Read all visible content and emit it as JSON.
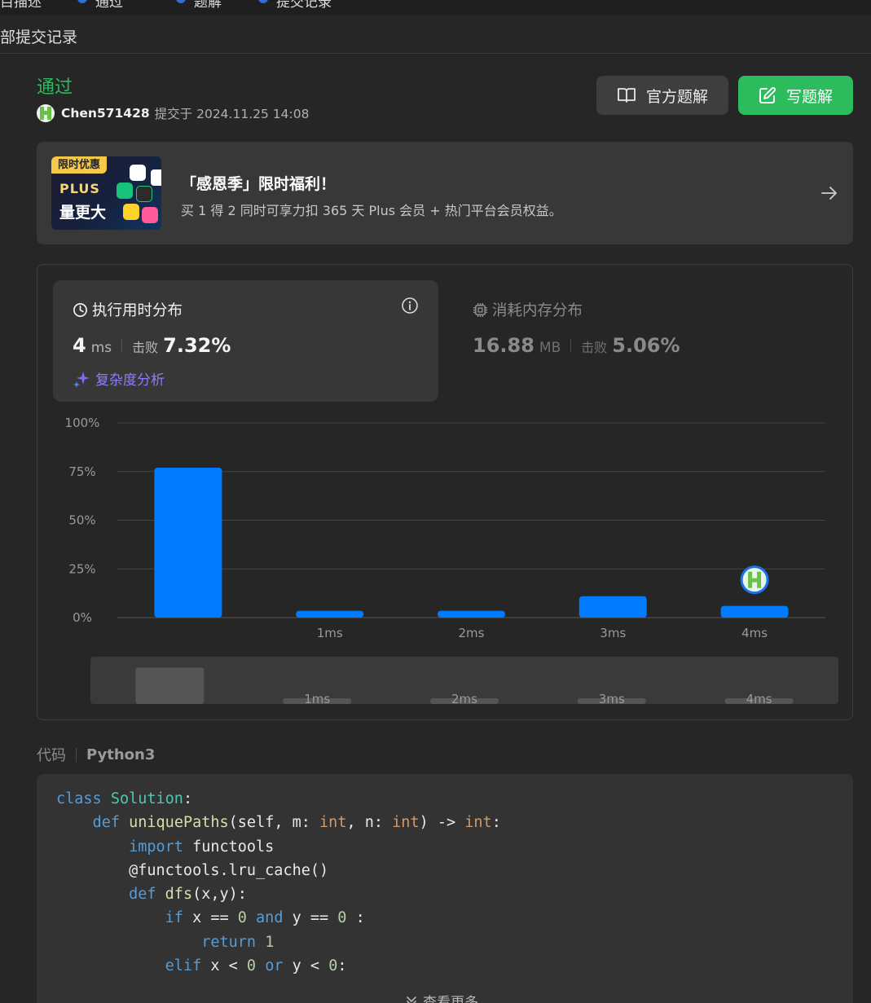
{
  "top_tabs": [
    {
      "label": "目描述"
    },
    {
      "label": "通过"
    },
    {
      "label": "题解"
    },
    {
      "label": "提交记录"
    }
  ],
  "subheader": {
    "title": "部提交记录"
  },
  "submission": {
    "status": "通过",
    "user": "Chen571428",
    "submitted_text": "提交于 2024.11.25 14:08"
  },
  "actions": {
    "official_solution": "官方题解",
    "write_solution": "写题解"
  },
  "promo": {
    "badge": "限时优惠",
    "plus": "PLUS",
    "sub": "量更大",
    "title": "「感恩季」限时福利！",
    "description": "买 1 得 2 同时可享力扣 365 天 Plus 会员 + 热门平台会员权益。",
    "icon": "arrow-right-icon"
  },
  "runtime": {
    "title": "执行用时分布",
    "value": "4",
    "unit": "ms",
    "beat_label": "击败",
    "beat_pct": "7.32%",
    "complexity_link": "复杂度分析",
    "icon": "clock-icon"
  },
  "memory": {
    "title": "消耗内存分布",
    "value": "16.88",
    "unit": "MB",
    "beat_label": "击败",
    "beat_pct": "5.06%",
    "icon": "chip-icon"
  },
  "chart_data": {
    "type": "bar",
    "categories": [
      "",
      "1ms",
      "2ms",
      "3ms",
      "4ms"
    ],
    "values": [
      77,
      3.5,
      3.5,
      11,
      6
    ],
    "y_ticks": [
      "100%",
      "75%",
      "50%",
      "25%",
      "0%"
    ],
    "ylim": [
      0,
      100
    ],
    "highlight_category": "4ms",
    "bar_color": "#007aff",
    "grid": true
  },
  "code": {
    "label": "代码",
    "language": "Python3",
    "lines": [
      "class Solution:",
      "    def uniquePaths(self, m: int, n: int) -> int:",
      "        import functools",
      "        @functools.lru_cache()",
      "        def dfs(x,y):",
      "            if x == 0 and y == 0 :",
      "                return 1",
      "            elif x < 0 or y < 0:"
    ],
    "view_more": "查看更多"
  }
}
